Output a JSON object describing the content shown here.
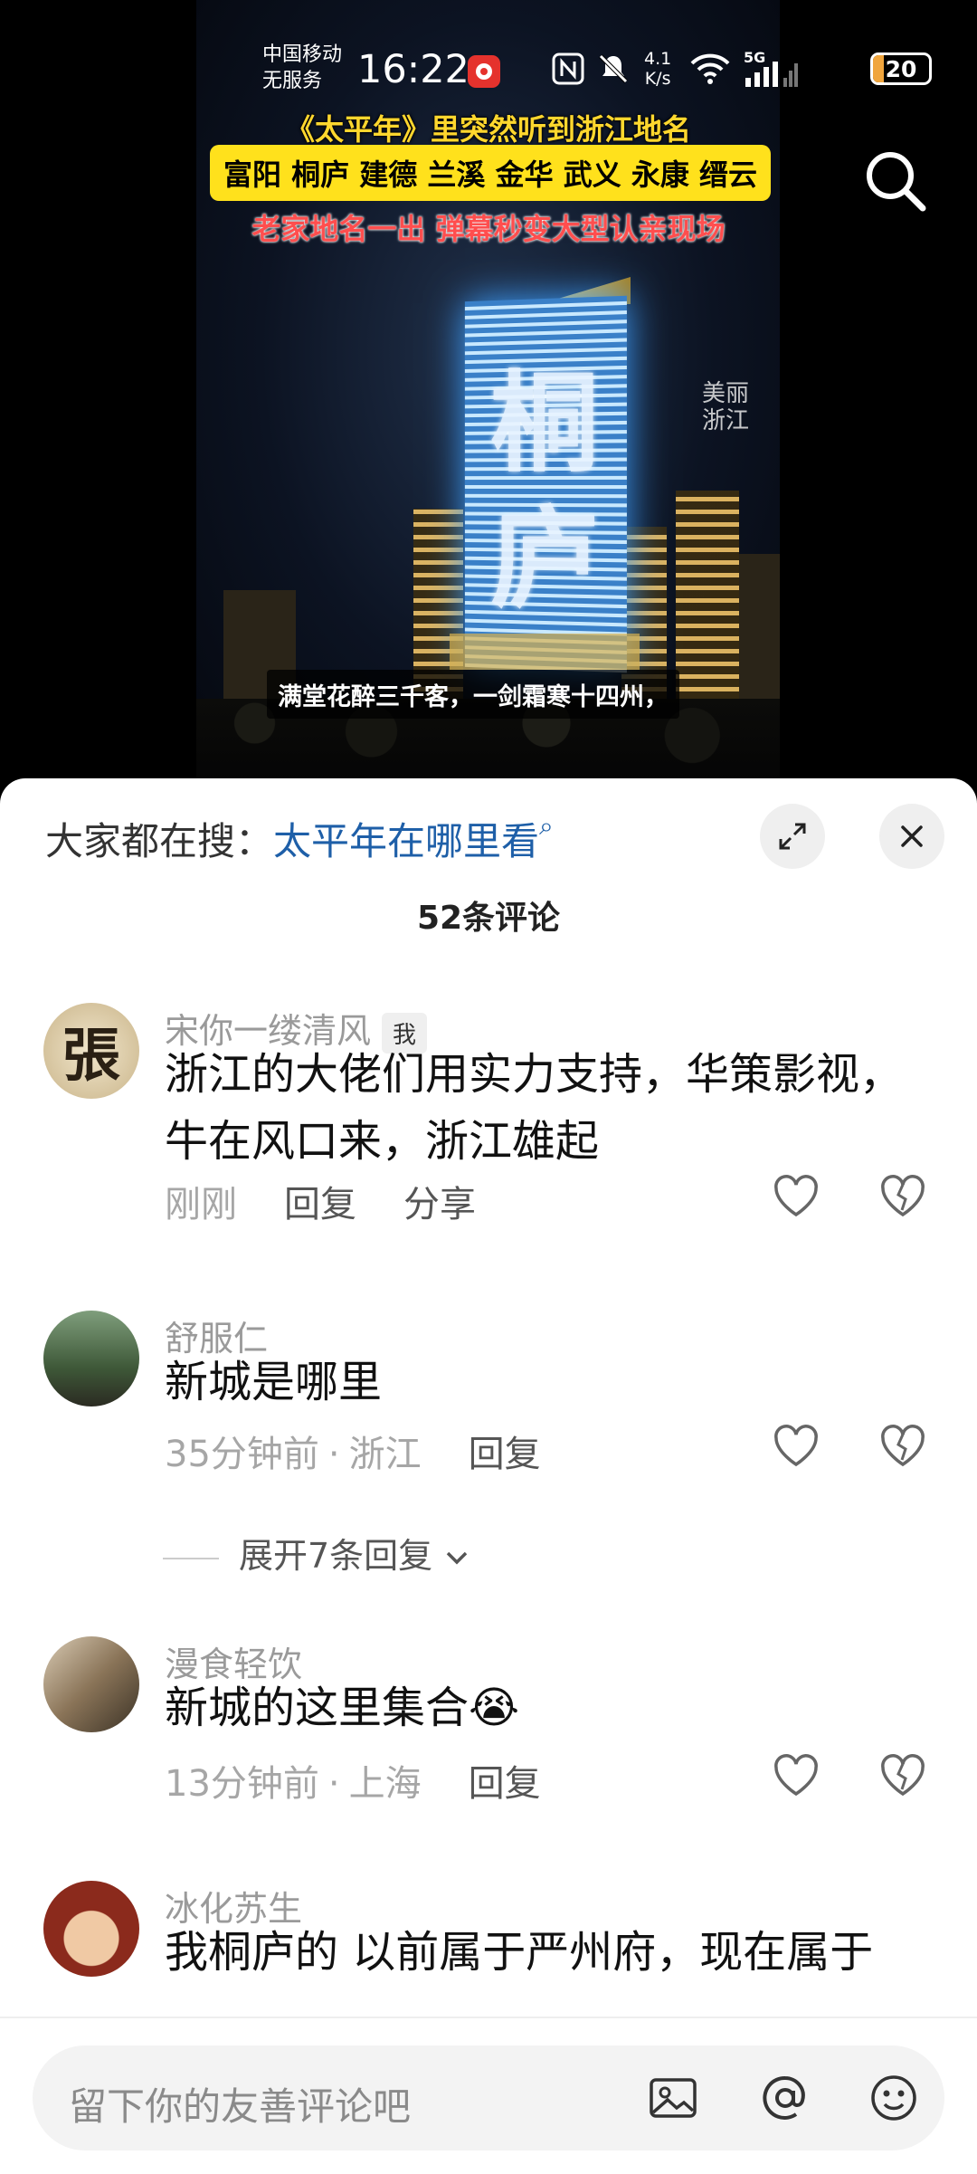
{
  "status_bar": {
    "carrier_line1": "中国移动",
    "carrier_line2": "无服务",
    "time": "16:22",
    "speed_value": "4.1",
    "speed_unit": "K/s",
    "network": "5G",
    "battery": "20",
    "battery_level": 0.2
  },
  "video": {
    "caption_line1": "《太平年》里突然听到浙江地名",
    "caption_line2": "富阳 桐庐 建德 兰溪 金华 武义 永康 缙云",
    "caption_line3": "老家地名一出 弹幕秒变大型认亲现场",
    "tower_char1": "桐",
    "tower_char2": "庐",
    "watermark": "美丽浙江",
    "subtitle": "满堂花醉三千客，一剑霜寒十四州，"
  },
  "sheet": {
    "trending_label": "大家都在搜：",
    "trending_query": "太平年在哪里看",
    "comment_count": "52条评论",
    "input_placeholder": "留下你的友善评论吧"
  },
  "comments": [
    {
      "user": "宋你一缕清风",
      "me_tag": "我",
      "text": "浙江的大佬们用实力支持，华策影视，牛在风口来，浙江雄起",
      "time": "刚刚",
      "reply": "回复",
      "share": "分享"
    },
    {
      "user": "舒服仁",
      "text": "新城是哪里",
      "time": "35分钟前",
      "location": "浙江",
      "reply": "回复",
      "expand": "展开7条回复"
    },
    {
      "user": "漫食轻饮",
      "text": "新城的这里集合😭",
      "time": "13分钟前",
      "location": "上海",
      "reply": "回复"
    },
    {
      "user": "冰化苏生",
      "text": "我桐庐的  以前属于严州府，现在属于"
    }
  ],
  "colors": {
    "caption_yellow": "#ffd72e",
    "caption_red": "#ff4e4e",
    "link_blue": "#1e5fa8",
    "battery_orange": "#f0a53d"
  },
  "icons": [
    "search-icon",
    "expand-icon",
    "close-icon",
    "heart-icon",
    "broken-heart-icon",
    "image-icon",
    "at-icon",
    "emoji-icon",
    "nfc-icon",
    "mute-icon",
    "wifi-icon",
    "signal-icon"
  ]
}
